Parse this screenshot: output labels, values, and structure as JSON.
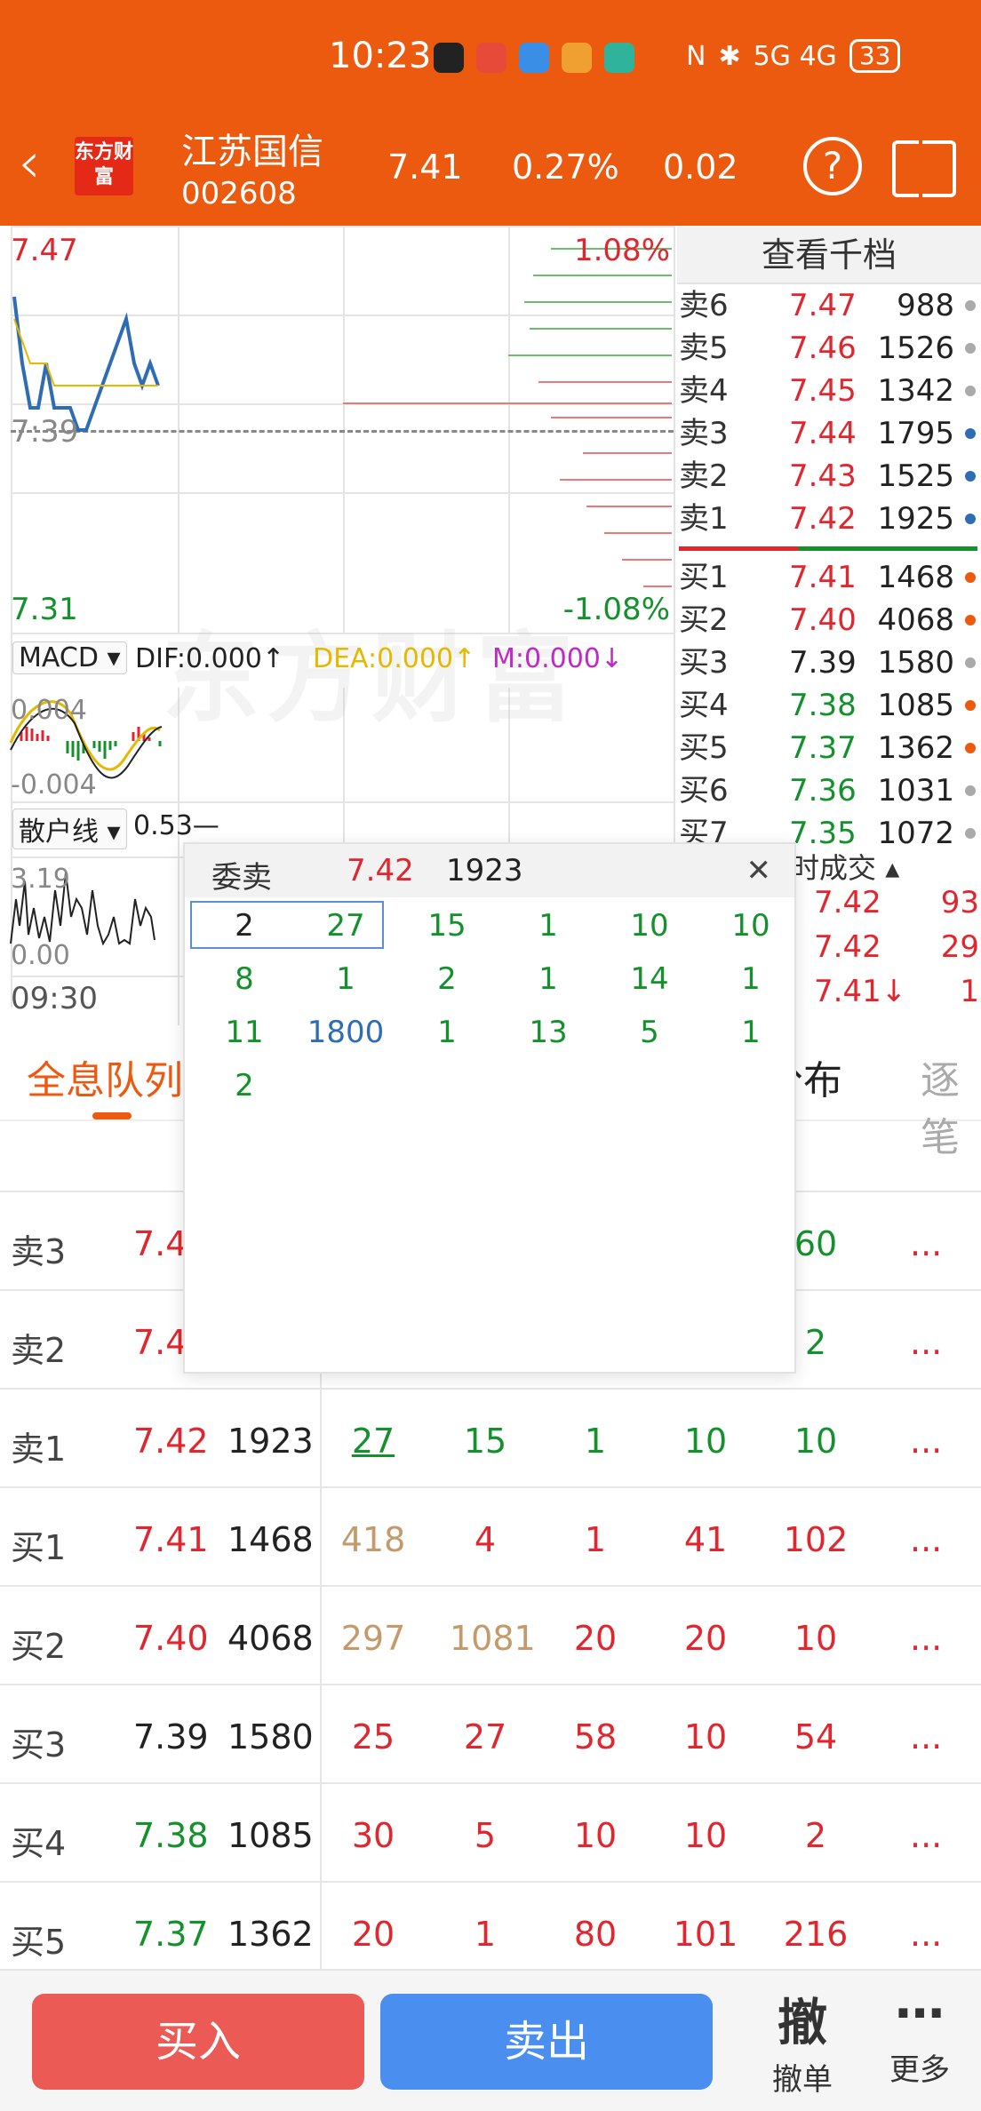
{
  "status_bar": {
    "time": "10:23",
    "network": "5G 4G",
    "battery": "33"
  },
  "header": {
    "name": "江苏国信",
    "code": "002608",
    "price": "7.41",
    "pct": "0.27%",
    "change": "0.02",
    "logo_text": "东方财富",
    "help_icon": "question-circle-icon",
    "split_icon": "split-screen-icon"
  },
  "intraday": {
    "top_price": "7.47",
    "top_pct": "1.08%",
    "mid_price": "7:39",
    "bottom_price": "7.31",
    "bottom_pct": "-1.08%",
    "watermark": "东方财富",
    "chart_data": {
      "type": "line",
      "series": [
        {
          "values": [
            7.45,
            7.42,
            7.4,
            7.4,
            7.42,
            7.4,
            7.4,
            7.4,
            7.39,
            7.39,
            7.4,
            7.41,
            7.42,
            7.43,
            7.44,
            7.42,
            7.41,
            7.42,
            7.41
          ]
        },
        {
          "values": [
            7.44,
            7.43,
            7.42,
            7.42,
            7.42,
            7.41,
            7.41,
            7.41,
            7.41,
            7.41,
            7.41,
            7.41,
            7.41,
            7.41,
            7.41,
            7.41,
            7.41,
            7.41,
            7.41
          ]
        }
      ]
    }
  },
  "macd": {
    "label": "MACD",
    "dif": "DIF:0.000",
    "dea": "DEA:0.000",
    "m": "M:0.000",
    "top": "0.004",
    "bottom": "-0.004"
  },
  "retail": {
    "label": "散户线",
    "value": "0.53—",
    "top": "3.19",
    "bottom": "0.00"
  },
  "time_label": "09:30",
  "order_book": {
    "title": "查看千档",
    "asks": [
      {
        "label": "卖6",
        "price": "7.47",
        "vol": "988",
        "dot": "#aaaaaa"
      },
      {
        "label": "卖5",
        "price": "7.46",
        "vol": "1526",
        "dot": "#aaaaaa"
      },
      {
        "label": "卖4",
        "price": "7.45",
        "vol": "1342",
        "dot": "#aaaaaa"
      },
      {
        "label": "卖3",
        "price": "7.44",
        "vol": "1795",
        "dot": "#2e6db4"
      },
      {
        "label": "卖2",
        "price": "7.43",
        "vol": "1525",
        "dot": "#2e6db4"
      },
      {
        "label": "卖1",
        "price": "7.42",
        "vol": "1925",
        "dot": "#2e6db4"
      }
    ],
    "bids": [
      {
        "label": "买1",
        "price": "7.41",
        "vol": "1468",
        "dot": "#ec5a10",
        "color": "red"
      },
      {
        "label": "买2",
        "price": "7.40",
        "vol": "4068",
        "dot": "#ec5a10",
        "color": "red"
      },
      {
        "label": "买3",
        "price": "7.39",
        "vol": "1580",
        "dot": "#aaaaaa",
        "color": "gray"
      },
      {
        "label": "买4",
        "price": "7.38",
        "vol": "1085",
        "dot": "#ec5a10",
        "color": "green"
      },
      {
        "label": "买5",
        "price": "7.37",
        "vol": "1362",
        "dot": "#ec5a10",
        "color": "green"
      },
      {
        "label": "买6",
        "price": "7.36",
        "vol": "1031",
        "dot": "#aaaaaa",
        "color": "green"
      },
      {
        "label": "买7",
        "price": "7.35",
        "vol": "1072",
        "dot": "#aaaaaa",
        "color": "green"
      }
    ]
  },
  "trades": {
    "title": "时成交",
    "rows": [
      {
        "price": "7.42",
        "vol": "93",
        "color": "red"
      },
      {
        "price": "7.42",
        "vol": "29",
        "color": "red"
      },
      {
        "price": "7.41↓",
        "vol": "1",
        "color": "red"
      }
    ]
  },
  "tabs": [
    {
      "label": "全息队列",
      "active": true
    },
    {
      "label": "分布"
    },
    {
      "label": "逐笔"
    }
  ],
  "queue_table": [
    {
      "label": "卖3",
      "price": "7.4",
      "pcolor": "red",
      "vol": "",
      "q": [
        "",
        "",
        "",
        "",
        "60"
      ],
      "qcolor": "green"
    },
    {
      "label": "卖2",
      "price": "7.4",
      "pcolor": "red",
      "vol": "",
      "q": [
        "",
        "",
        "",
        "",
        "2"
      ],
      "qcolor": "green"
    },
    {
      "label": "卖1",
      "price": "7.42",
      "pcolor": "red",
      "vol": "1923",
      "q": [
        "27",
        "15",
        "1",
        "10",
        "10"
      ],
      "qcolor": "green"
    },
    {
      "label": "买1",
      "price": "7.41",
      "pcolor": "red",
      "vol": "1468",
      "q": [
        "418",
        "4",
        "1",
        "41",
        "102"
      ],
      "qcolor": "red"
    },
    {
      "label": "买2",
      "price": "7.40",
      "pcolor": "red",
      "vol": "4068",
      "q": [
        "297",
        "1081",
        "20",
        "20",
        "10"
      ],
      "qcolor": "red"
    },
    {
      "label": "买3",
      "price": "7.39",
      "pcolor": "gray",
      "vol": "1580",
      "q": [
        "25",
        "27",
        "58",
        "10",
        "54"
      ],
      "qcolor": "red"
    },
    {
      "label": "买4",
      "price": "7.38",
      "pcolor": "green",
      "vol": "1085",
      "q": [
        "30",
        "5",
        "10",
        "10",
        "2"
      ],
      "qcolor": "red"
    },
    {
      "label": "买5",
      "price": "7.37",
      "pcolor": "green",
      "vol": "1362",
      "q": [
        "20",
        "1",
        "80",
        "101",
        "216"
      ],
      "qcolor": "red"
    }
  ],
  "more": "...",
  "popup": {
    "title": "委卖",
    "price": "7.42",
    "volume": "1923",
    "close_icon": "close-icon",
    "rows": [
      [
        "2",
        "27",
        "15",
        "1",
        "10",
        "10"
      ],
      [
        "8",
        "1",
        "2",
        "1",
        "14",
        "1"
      ],
      [
        "11",
        "1800",
        "1",
        "13",
        "5",
        "1"
      ],
      [
        "2"
      ]
    ]
  },
  "bottom": {
    "buy": "买入",
    "sell": "卖出",
    "cancel_icon_text": "撤",
    "cancel": "撤单",
    "more_icon": "more-dots-icon",
    "more": "更多"
  }
}
